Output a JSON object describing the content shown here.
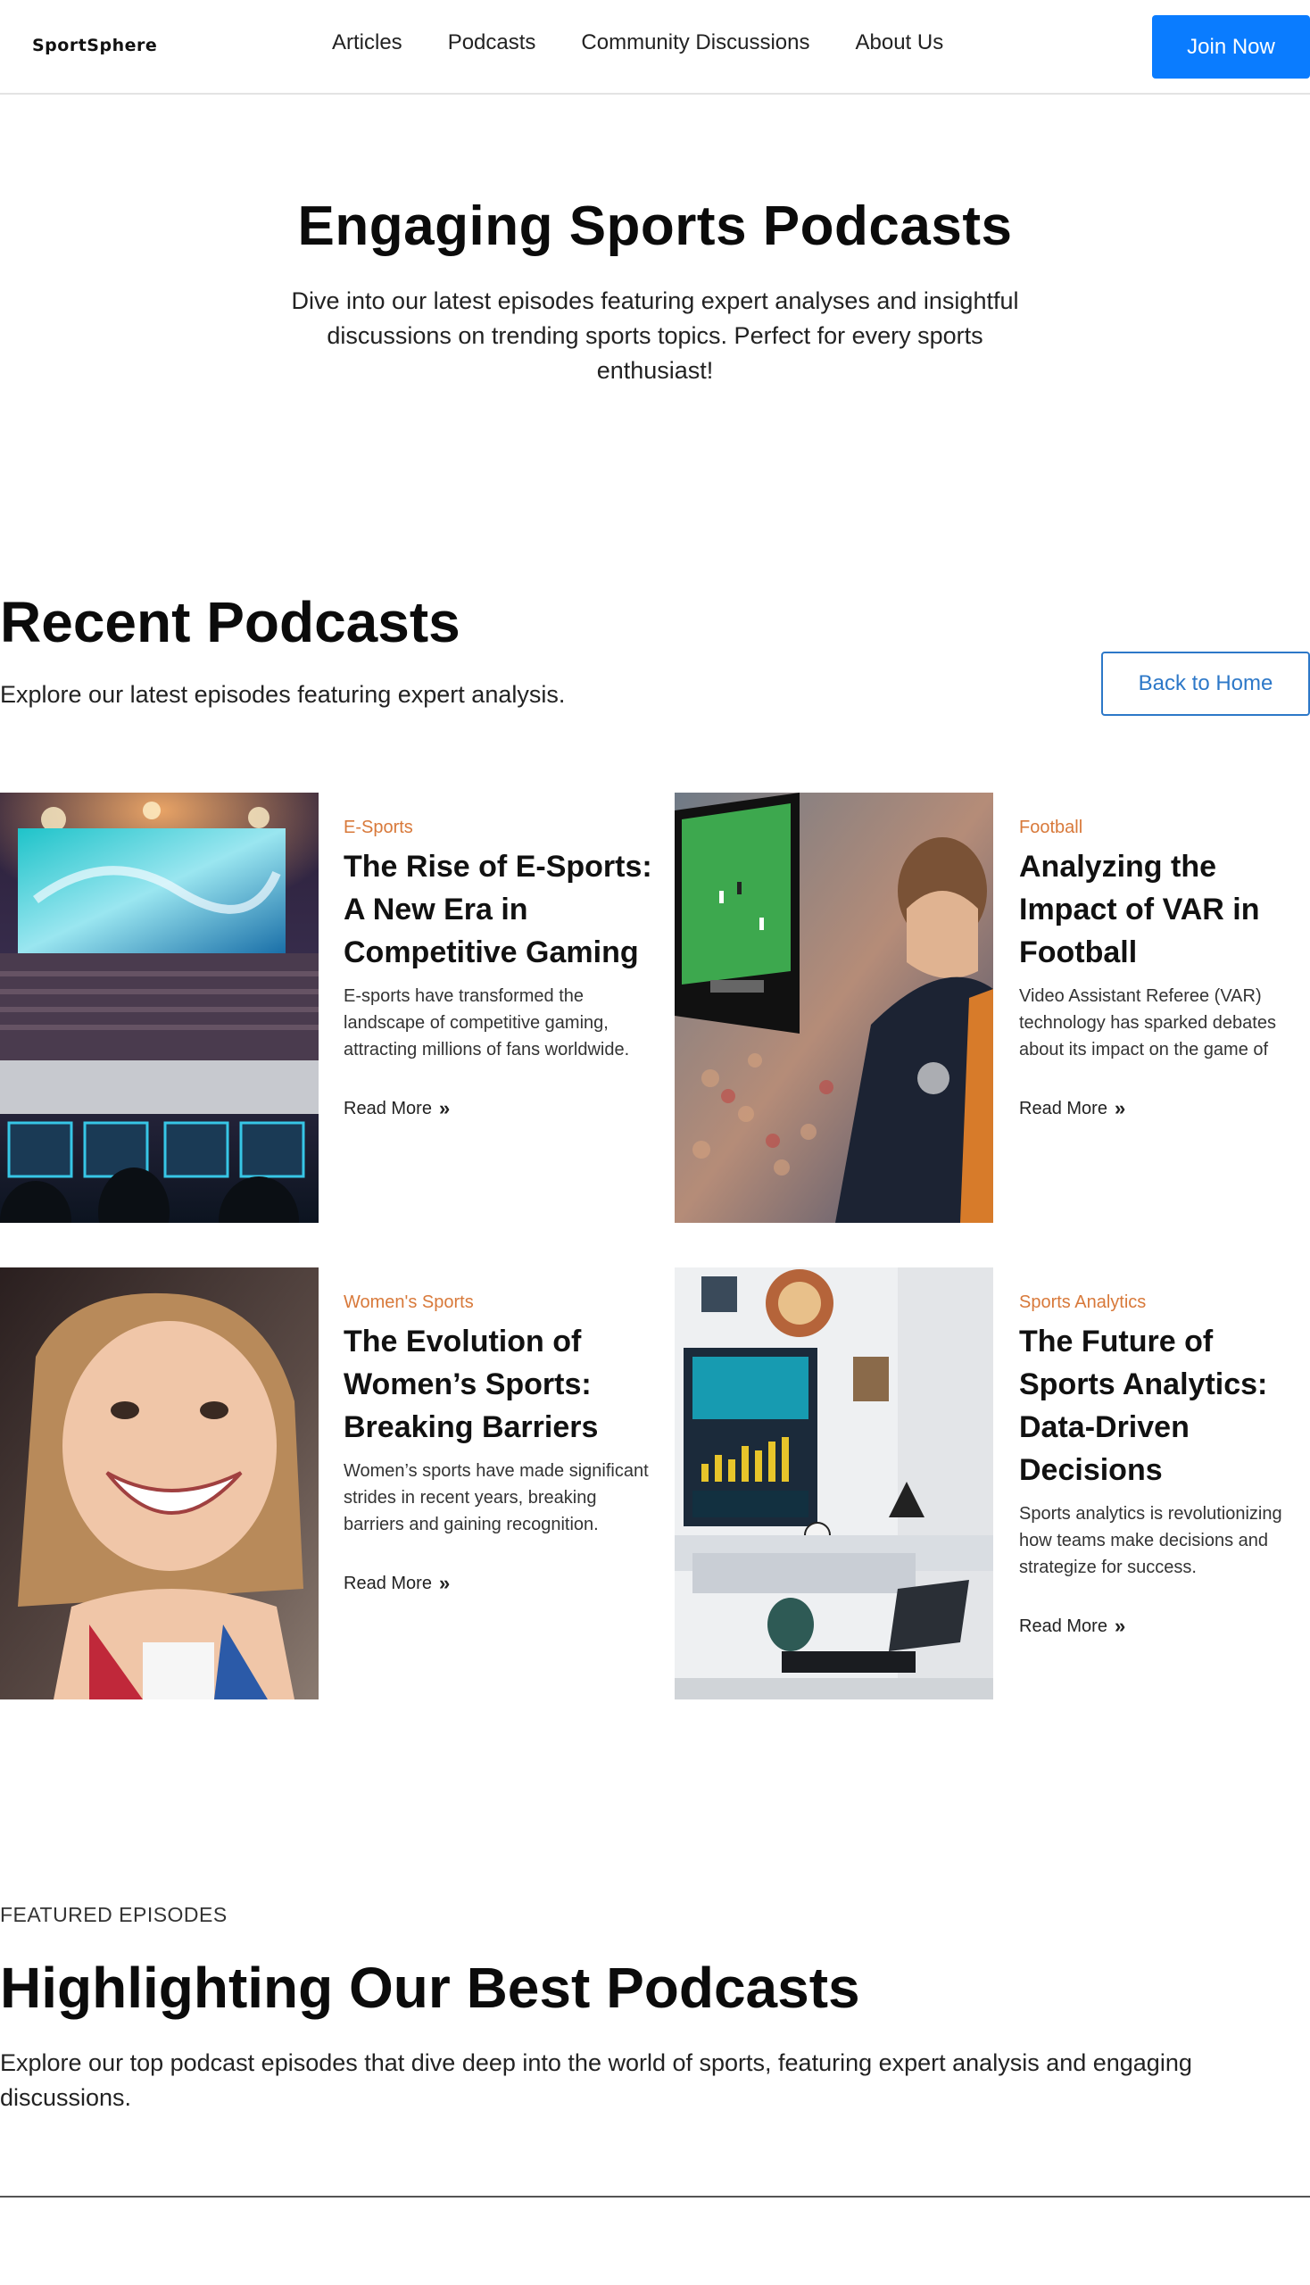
{
  "nav": {
    "logo": "SportSphere",
    "links": [
      "Articles",
      "Podcasts",
      "Community Discussions",
      "About Us"
    ],
    "cta": "Join Now"
  },
  "hero": {
    "title": "Engaging Sports Podcasts",
    "subtitle": "Dive into our latest episodes featuring expert analyses and insightful discussions on trending sports topics. Perfect for every sports enthusiast!"
  },
  "recent": {
    "title": "Recent Podcasts",
    "subtitle": "Explore our latest episodes featuring expert analysis.",
    "back_button": "Back to Home",
    "read_more": "Read More",
    "cards": [
      {
        "category": "E-Sports",
        "title": "The Rise of E-Sports: A New Era in Competitive Gaming",
        "description": "E-sports have transformed the landscape of competitive gaming, attracting millions of fans worldwide."
      },
      {
        "category": "Football",
        "title": "Analyzing the Impact of VAR in Football",
        "description": "Video Assistant Referee (VAR) technology has sparked debates about its impact on the game of"
      },
      {
        "category": "Women's Sports",
        "title": "The Evolution of Women’s Sports: Breaking Barriers",
        "description": "Women’s sports have made significant strides in recent years, breaking barriers and gaining recognition."
      },
      {
        "category": "Sports Analytics",
        "title": "The Future of Sports Analytics: Data-Driven Decisions",
        "description": "Sports analytics is revolutionizing how teams make decisions and strategize for success."
      }
    ]
  },
  "featured": {
    "kicker": "FEATURED EPISODES",
    "title": "Highlighting Our Best Podcasts",
    "subtitle": "Explore our top podcast episodes that dive deep into the world of sports, featuring expert analysis and engaging discussions."
  },
  "colors": {
    "primary": "#0a7cff",
    "outline": "#2d78c8",
    "category": "#d8793a"
  },
  "icons": {
    "read_more": "double-chevron-right-icon"
  }
}
